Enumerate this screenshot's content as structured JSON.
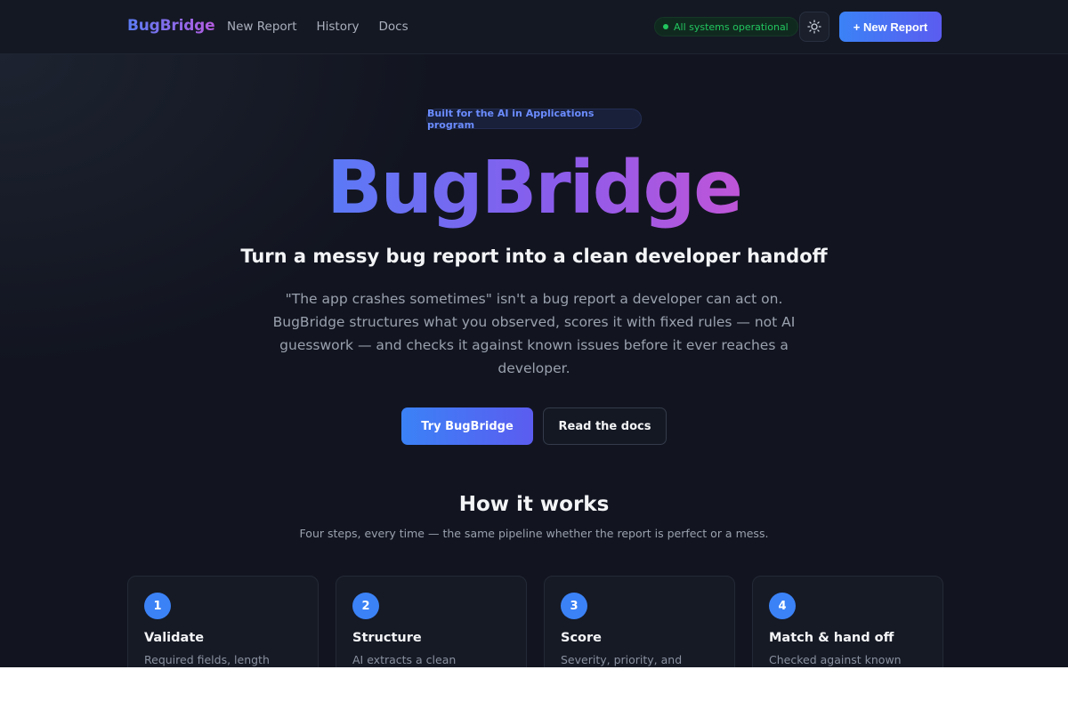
{
  "nav": {
    "brand": "BugBridge",
    "links": [
      "New Report",
      "History",
      "Docs"
    ],
    "status": "All systems operational",
    "theme_icon": "sun-icon",
    "new_report_label": "+ New Report"
  },
  "hero": {
    "badge": "Built for the AI in Applications program",
    "title": "BugBridge",
    "subtitle": "Turn a messy bug report into a clean developer handoff",
    "description": "\"The app crashes sometimes\" isn't a bug report a developer can act on. BugBridge structures what you observed, scores it with fixed rules — not AI guesswork — and checks it against known issues before it ever reaches a developer.",
    "primary_cta": "Try BugBridge",
    "secondary_cta": "Read the docs"
  },
  "how_it_works": {
    "title": "How it works",
    "subtitle": "Four steps, every time — the same pipeline whether the report is perfect or a mess.",
    "steps": [
      {
        "number": "1",
        "title": "Validate",
        "desc": "Required fields, length"
      },
      {
        "number": "2",
        "title": "Structure",
        "desc": "AI extracts a clean summary,"
      },
      {
        "number": "3",
        "title": "Score",
        "desc": "Severity, priority, and"
      },
      {
        "number": "4",
        "title": "Match & hand off",
        "desc": "Checked against known"
      }
    ]
  },
  "colors": {
    "background": "#121520",
    "accent_blue": "#3b82f6",
    "accent_purple": "#b45ce0",
    "status_green": "#22c55e"
  }
}
